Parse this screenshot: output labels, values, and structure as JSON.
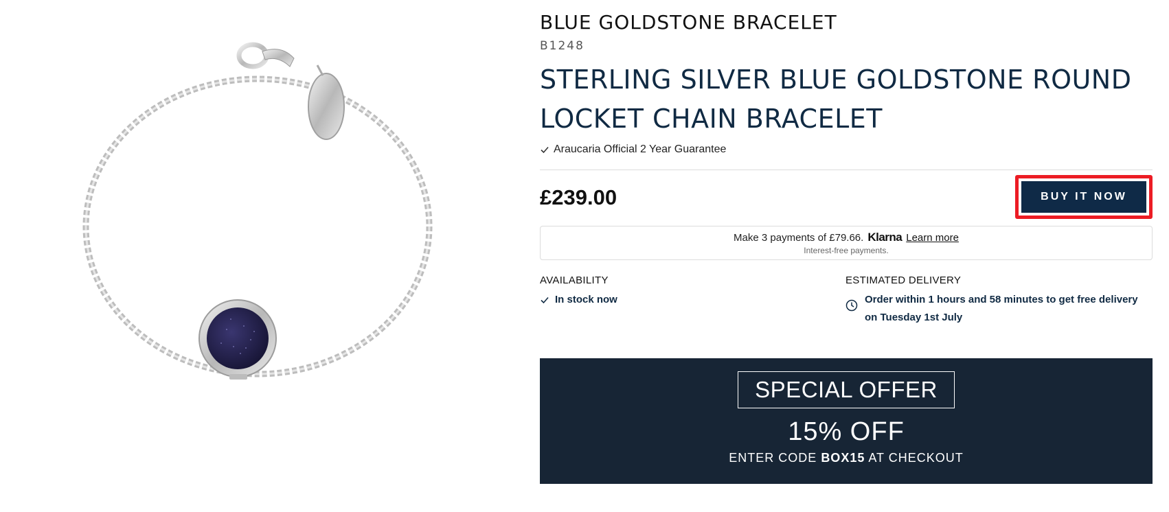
{
  "product": {
    "collection_title": "BLUE GOLDSTONE BRACELET",
    "sku": "B1248",
    "title": "STERLING SILVER BLUE GOLDSTONE ROUND LOCKET CHAIN BRACELET",
    "guarantee": "Araucaria Official 2 Year Guarantee",
    "price": "£239.00",
    "image_icon": "bracelet-product-image"
  },
  "actions": {
    "buy_label": "BUY IT NOW"
  },
  "klarna": {
    "text": "Make 3 payments of £79.66.",
    "logo": "Klarna",
    "learn_more": "Learn more",
    "subtext": "Interest-free payments."
  },
  "availability": {
    "label": "AVAILABILITY",
    "status": "In stock now"
  },
  "delivery": {
    "label": "ESTIMATED DELIVERY",
    "message": "Order within 1 hours and 58 minutes to get free delivery on Tuesday 1st July"
  },
  "offer": {
    "heading": "SPECIAL OFFER",
    "discount": "15% OFF",
    "code_prefix": "ENTER CODE",
    "code": "BOX15",
    "code_suffix": "AT CHECKOUT"
  },
  "colors": {
    "navy": "#0f2a47",
    "offer_bg": "#172535",
    "highlight": "#ec1c24",
    "goldstone": "#24214a"
  }
}
